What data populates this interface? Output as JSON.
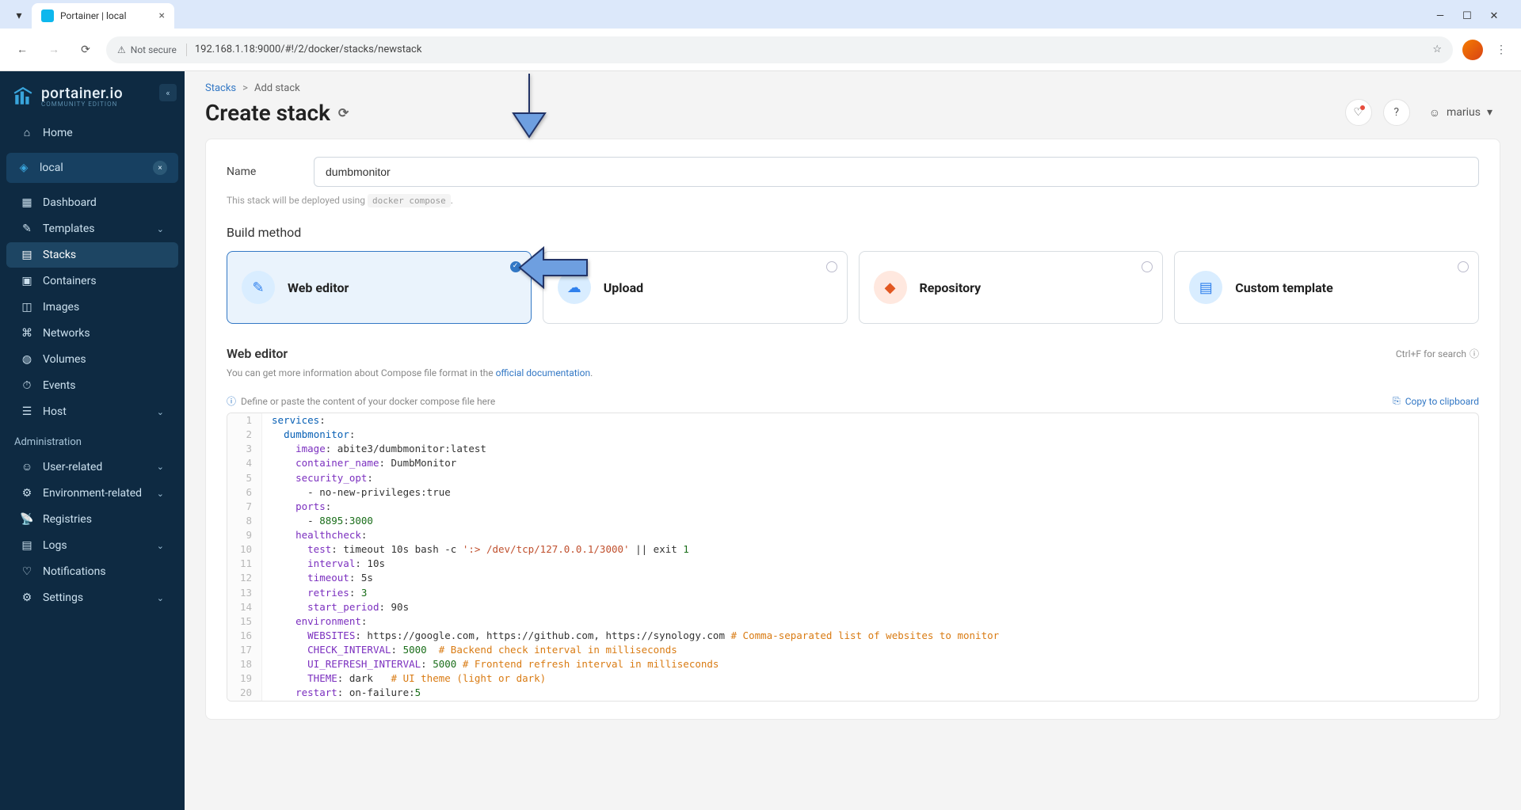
{
  "browser": {
    "tab_title": "Portainer | local",
    "url": "192.168.1.18:9000/#!/2/docker/stacks/newstack",
    "not_secure": "Not secure"
  },
  "brand": {
    "name": "portainer.io",
    "sub": "COMMUNITY EDITION"
  },
  "sidebar": {
    "home": "Home",
    "env": "local",
    "items": [
      "Dashboard",
      "Templates",
      "Stacks",
      "Containers",
      "Images",
      "Networks",
      "Volumes",
      "Events",
      "Host"
    ],
    "admin_label": "Administration",
    "admin_items": [
      "User-related",
      "Environment-related",
      "Registries",
      "Logs",
      "Notifications",
      "Settings"
    ]
  },
  "breadcrumb": {
    "root": "Stacks",
    "current": "Add stack"
  },
  "title": "Create stack",
  "user": "marius",
  "form": {
    "name_label": "Name",
    "name_value": "dumbmonitor",
    "hint_pre": "This stack will be deployed using ",
    "hint_code": "docker compose",
    "hint_post": "."
  },
  "build": {
    "section": "Build method",
    "options": [
      "Web editor",
      "Upload",
      "Repository",
      "Custom template"
    ]
  },
  "editor": {
    "title": "Web editor",
    "shortcut": "Ctrl+F for search",
    "desc_pre": "You can get more information about Compose file format in the ",
    "desc_link": "official documentation",
    "desc_post": ".",
    "placeholder": "Define or paste the content of your docker compose file here",
    "copy": "Copy to clipboard"
  },
  "code_lines": [
    [
      [
        "kw",
        "services"
      ],
      [
        "p",
        ":"
      ]
    ],
    [
      [
        "p",
        "  "
      ],
      [
        "kw",
        "dumbmonitor"
      ],
      [
        "p",
        ":"
      ]
    ],
    [
      [
        "p",
        "    "
      ],
      [
        "key",
        "image"
      ],
      [
        "p",
        ": abite3/dumbmonitor:latest"
      ]
    ],
    [
      [
        "p",
        "    "
      ],
      [
        "key",
        "container_name"
      ],
      [
        "p",
        ": DumbMonitor"
      ]
    ],
    [
      [
        "p",
        "    "
      ],
      [
        "key",
        "security_opt"
      ],
      [
        "p",
        ":"
      ]
    ],
    [
      [
        "p",
        "      - no-new-privileges:true"
      ]
    ],
    [
      [
        "p",
        "    "
      ],
      [
        "key",
        "ports"
      ],
      [
        "p",
        ":"
      ]
    ],
    [
      [
        "p",
        "      - "
      ],
      [
        "num",
        "8895"
      ],
      [
        "p",
        ":"
      ],
      [
        "num",
        "3000"
      ]
    ],
    [
      [
        "p",
        "    "
      ],
      [
        "key",
        "healthcheck"
      ],
      [
        "p",
        ":"
      ]
    ],
    [
      [
        "p",
        "      "
      ],
      [
        "key",
        "test"
      ],
      [
        "p",
        ": timeout 10s bash -c "
      ],
      [
        "str",
        "':> /dev/tcp/127.0.0.1/3000'"
      ],
      [
        "p",
        " || exit "
      ],
      [
        "num",
        "1"
      ]
    ],
    [
      [
        "p",
        "      "
      ],
      [
        "key",
        "interval"
      ],
      [
        "p",
        ": 10s"
      ]
    ],
    [
      [
        "p",
        "      "
      ],
      [
        "key",
        "timeout"
      ],
      [
        "p",
        ": 5s"
      ]
    ],
    [
      [
        "p",
        "      "
      ],
      [
        "key",
        "retries"
      ],
      [
        "p",
        ": "
      ],
      [
        "num",
        "3"
      ]
    ],
    [
      [
        "p",
        "      "
      ],
      [
        "key",
        "start_period"
      ],
      [
        "p",
        ": 90s"
      ]
    ],
    [
      [
        "p",
        "    "
      ],
      [
        "key",
        "environment"
      ],
      [
        "p",
        ":"
      ]
    ],
    [
      [
        "p",
        "      "
      ],
      [
        "key",
        "WEBSITES"
      ],
      [
        "p",
        ": https://google.com, https://github.com, https://synology.com "
      ],
      [
        "comment",
        "# Comma-separated list of websites to monitor"
      ]
    ],
    [
      [
        "p",
        "      "
      ],
      [
        "key",
        "CHECK_INTERVAL"
      ],
      [
        "p",
        ": "
      ],
      [
        "num",
        "5000"
      ],
      [
        "p",
        "  "
      ],
      [
        "comment",
        "# Backend check interval in milliseconds"
      ]
    ],
    [
      [
        "p",
        "      "
      ],
      [
        "key",
        "UI_REFRESH_INTERVAL"
      ],
      [
        "p",
        ": "
      ],
      [
        "num",
        "5000"
      ],
      [
        "p",
        " "
      ],
      [
        "comment",
        "# Frontend refresh interval in milliseconds"
      ]
    ],
    [
      [
        "p",
        "      "
      ],
      [
        "key",
        "THEME"
      ],
      [
        "p",
        ": dark   "
      ],
      [
        "comment",
        "# UI theme (light or dark)"
      ]
    ],
    [
      [
        "p",
        "    "
      ],
      [
        "key",
        "restart"
      ],
      [
        "p",
        ": on-failure:"
      ],
      [
        "num",
        "5"
      ]
    ]
  ]
}
